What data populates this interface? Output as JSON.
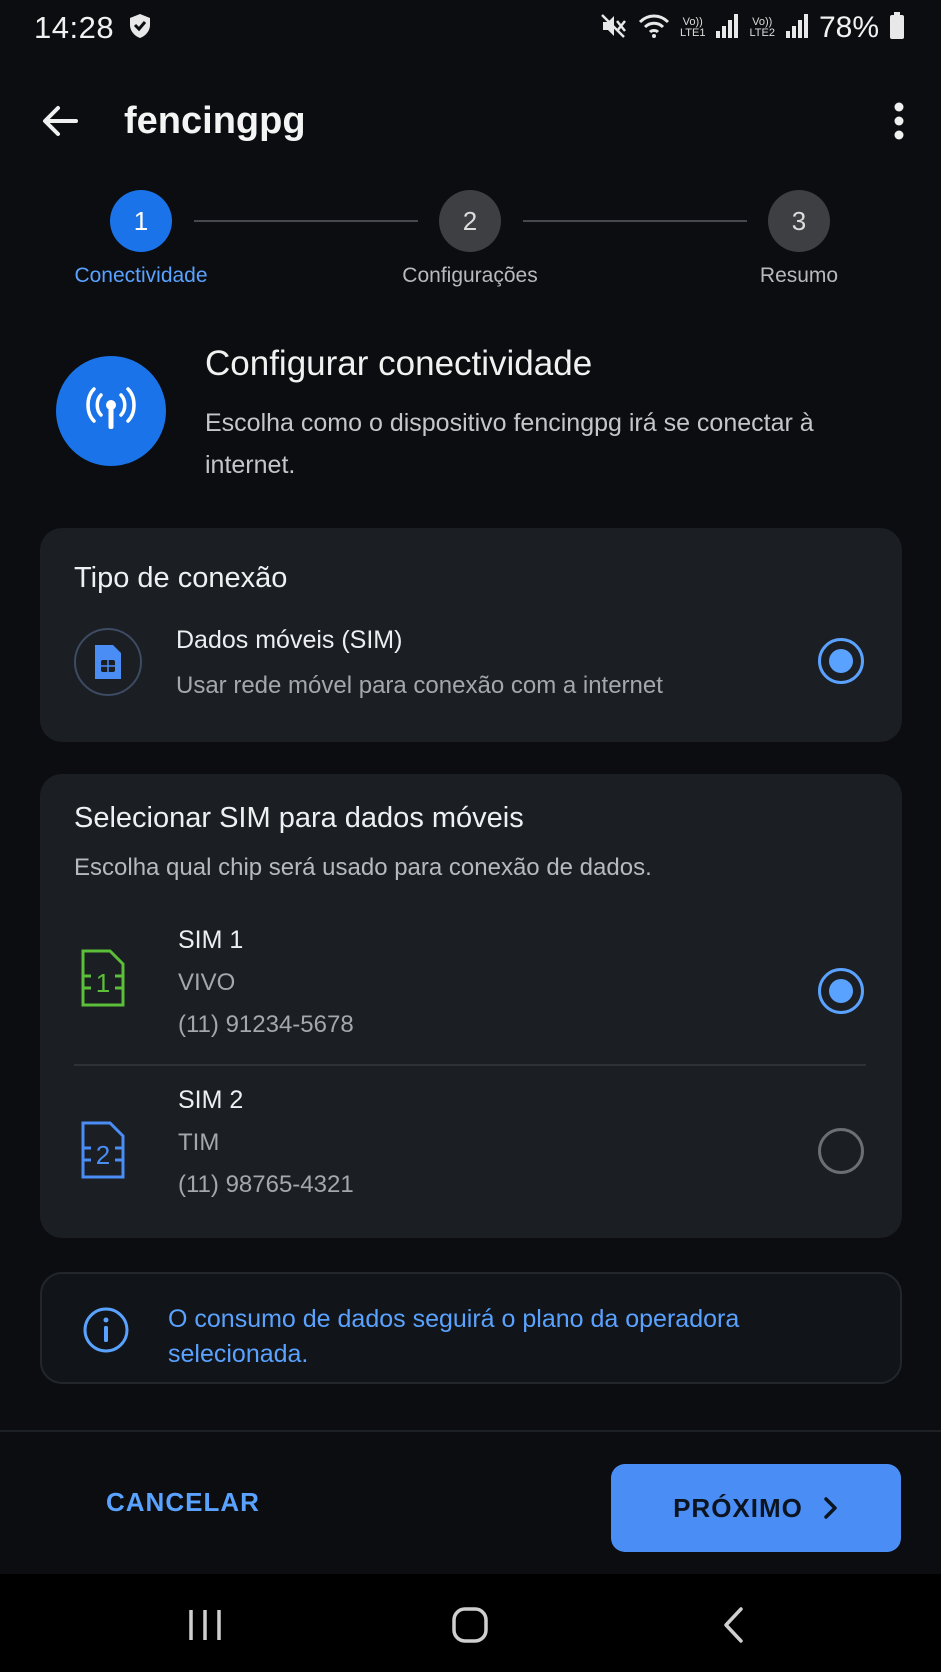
{
  "status_bar": {
    "time": "14:28",
    "lte1_top": "Vo))",
    "lte1_bottom": "LTE1",
    "lte2_top": "Vo))",
    "lte2_bottom": "LTE2",
    "battery": "78%",
    "icons": [
      "shield-icon",
      "mute-icon",
      "wifi-icon",
      "signal-icon",
      "signal-icon",
      "battery-icon"
    ]
  },
  "app_bar": {
    "title": "fencingpg",
    "icons": [
      "back-arrow-icon",
      "more-vert-icon"
    ]
  },
  "stepper": {
    "steps": [
      {
        "number": "1",
        "label": "Conectividade",
        "active": true
      },
      {
        "number": "2",
        "label": "Configurações",
        "active": false
      },
      {
        "number": "3",
        "label": "Resumo",
        "active": false
      }
    ]
  },
  "intro": {
    "title": "Configurar conectividade",
    "description": "Escolha como o dispositivo fencingpg irá se conectar à internet.",
    "icon": "antenna-icon"
  },
  "connection_card": {
    "title": "Tipo de conexão",
    "option": {
      "title": "Dados móveis (SIM)",
      "subtitle": "Usar rede móvel para conexão com a internet",
      "selected": true,
      "icon": "sim-card-icon"
    }
  },
  "sim_card": {
    "title": "Selecionar SIM para dados móveis",
    "subtitle": "Escolha qual chip será usado para conexão de dados.",
    "sims": [
      {
        "name": "SIM 1",
        "carrier": "VIVO",
        "number": "(11) 91234-5678",
        "selected": true,
        "icon": "sim-1-icon",
        "color": "#5bbf3a",
        "digit": "1"
      },
      {
        "name": "SIM 2",
        "carrier": "TIM",
        "number": "(11) 98765-4321",
        "selected": false,
        "icon": "sim-2-icon",
        "color": "#4a8ef5",
        "digit": "2"
      }
    ]
  },
  "info": {
    "text": "O consumo de dados seguirá o plano da operadora selecionada.",
    "icon": "info-icon"
  },
  "actions": {
    "cancel": "CANCELAR",
    "next": "PRÓXIMO"
  },
  "colors": {
    "accent": "#1a73e8",
    "accent_light": "#5aa2ff",
    "sim1": "#5bbf3a",
    "sim2": "#4a8ef5"
  }
}
